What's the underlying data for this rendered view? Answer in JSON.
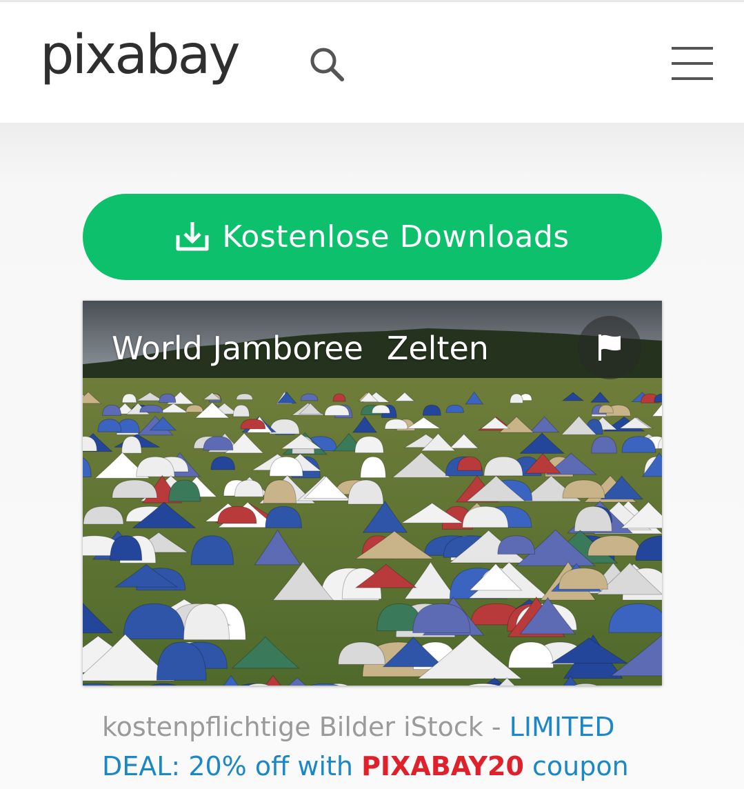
{
  "header": {
    "logo_text": "pixabay",
    "search_icon": "search-icon",
    "menu_icon": "hamburger-menu-icon"
  },
  "download_button": {
    "label": "Kostenlose Downloads",
    "icon": "download-icon",
    "color": "#0cc06c"
  },
  "photo": {
    "tags": [
      "World Jamboree",
      "Zelten"
    ],
    "flag_icon": "flag-icon"
  },
  "ad": {
    "prefix": "kostenpflichtige Bilder iStock - ",
    "deal_label": "LIMITED DEAL: 20% off with ",
    "coupon_code": "PIXABAY20",
    "suffix": " coupon",
    "link_color": "#1a87c9",
    "code_color": "#e0202b"
  }
}
